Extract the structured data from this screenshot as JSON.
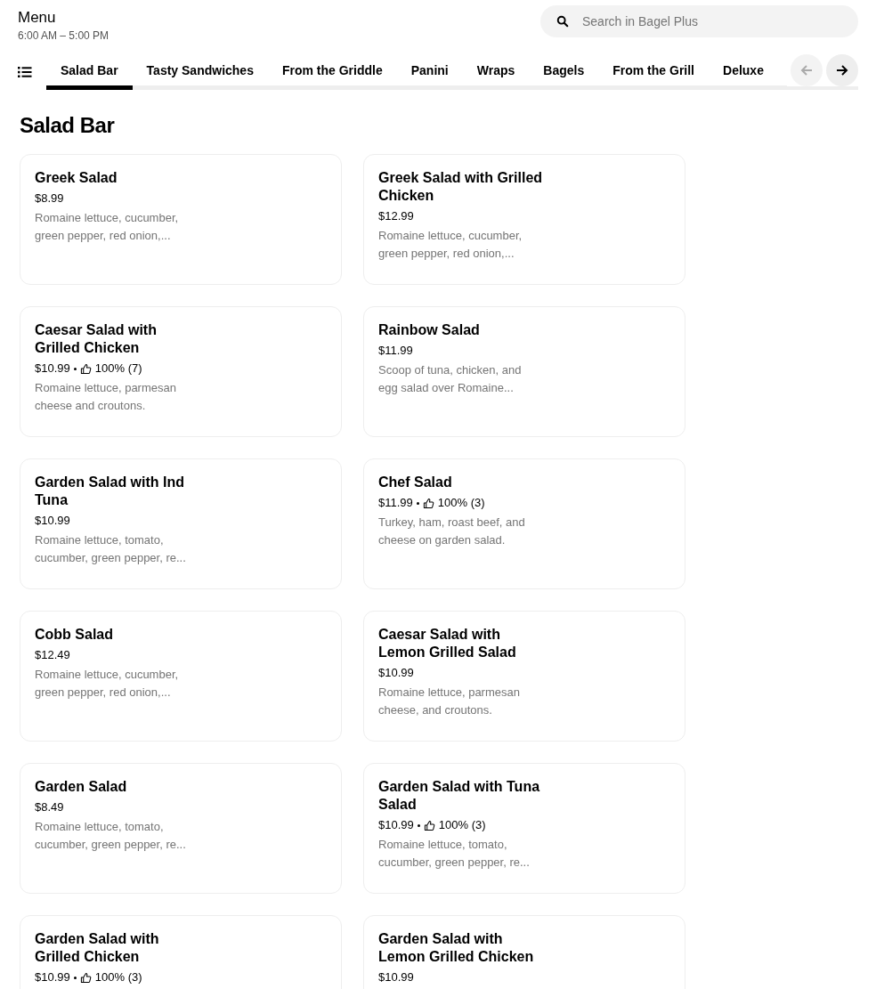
{
  "header": {
    "title": "Menu",
    "hours": "6:00 AM – 5:00 PM"
  },
  "search": {
    "placeholder": "Search in Bagel Plus"
  },
  "tabs": [
    {
      "label": "Salad Bar",
      "selected": true
    },
    {
      "label": "Tasty Sandwiches",
      "selected": false
    },
    {
      "label": "From the Griddle",
      "selected": false
    },
    {
      "label": "Panini",
      "selected": false
    },
    {
      "label": "Wraps",
      "selected": false
    },
    {
      "label": "Bagels",
      "selected": false
    },
    {
      "label": "From the Grill",
      "selected": false
    },
    {
      "label": "Deluxe",
      "selected": false
    }
  ],
  "scroll_buttons": [
    {
      "kind": "previous",
      "disabled": true
    },
    {
      "kind": "next",
      "disabled": false
    }
  ],
  "section": {
    "title": "Salad Bar"
  },
  "items": [
    {
      "name": "Greek Salad",
      "price": "$8.99",
      "description": "Romaine lettuce, cucumber, green pepper, red onion,..."
    },
    {
      "name": "Greek Salad with Grilled Chicken",
      "price": "$12.99",
      "description": "Romaine lettuce, cucumber, green pepper, red onion,..."
    },
    {
      "name": "Caesar Salad with Grilled Chicken",
      "price": "$10.99",
      "rating": "100% (7)",
      "description": "Romaine lettuce, parmesan cheese and croutons."
    },
    {
      "name": "Rainbow Salad",
      "price": "$11.99",
      "description": "Scoop of tuna, chicken, and egg salad over Romaine..."
    },
    {
      "name": "Garden Salad with Ind Tuna",
      "price": "$10.99",
      "description": "Romaine lettuce, tomato, cucumber, green pepper, re..."
    },
    {
      "name": "Chef Salad",
      "price": "$11.99",
      "rating": "100% (3)",
      "description": "Turkey, ham, roast beef, and cheese on garden salad."
    },
    {
      "name": "Cobb Salad",
      "price": "$12.49",
      "description": "Romaine lettuce, cucumber, green pepper, red onion,..."
    },
    {
      "name": "Caesar Salad with Lemon Grilled Salad",
      "price": "$10.99",
      "description": "Romaine lettuce, parmesan cheese, and croutons."
    },
    {
      "name": "Garden Salad",
      "price": "$8.49",
      "description": "Romaine lettuce, tomato, cucumber, green pepper, re..."
    },
    {
      "name": "Garden Salad with Tuna Salad",
      "price": "$10.99",
      "rating": "100% (3)",
      "description": "Romaine lettuce, tomato, cucumber, green pepper, re..."
    },
    {
      "name": "Garden Salad with Grilled Chicken",
      "price": "$10.99",
      "rating": "100% (3)"
    },
    {
      "name": "Garden Salad with Lemon Grilled Chicken",
      "price": "$10.99"
    }
  ]
}
